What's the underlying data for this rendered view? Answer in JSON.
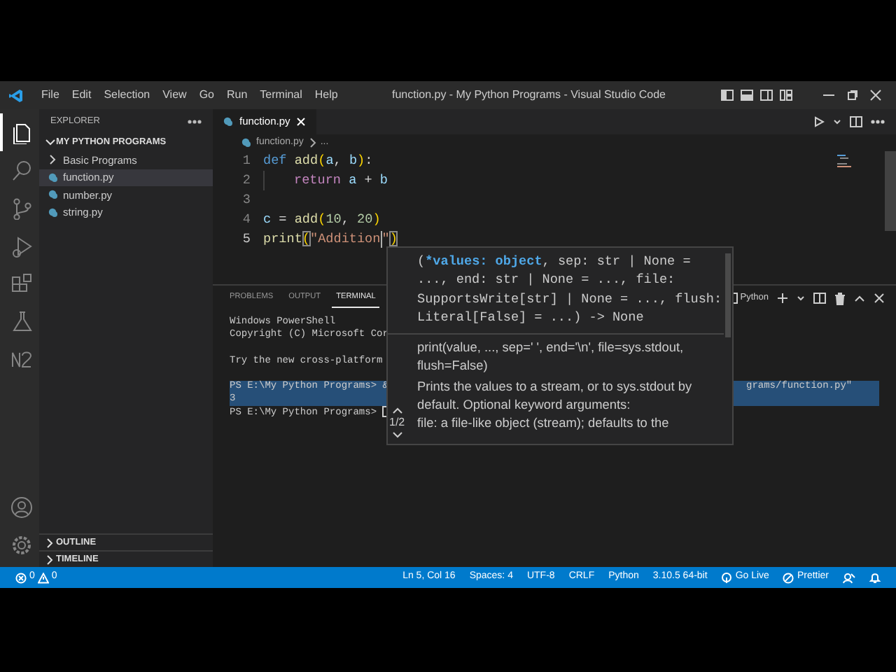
{
  "window": {
    "title": "function.py - My Python Programs - Visual Studio Code",
    "menu": [
      "File",
      "Edit",
      "Selection",
      "View",
      "Go",
      "Run",
      "Terminal",
      "Help"
    ]
  },
  "activity_bar": [
    {
      "kind": "explorer",
      "selected": true
    },
    {
      "kind": "search",
      "selected": false
    },
    {
      "kind": "source-control",
      "selected": false
    },
    {
      "kind": "run-debug",
      "selected": false
    },
    {
      "kind": "extensions",
      "selected": false
    },
    {
      "kind": "testing",
      "selected": false
    },
    {
      "kind": "extension-n2",
      "selected": false
    }
  ],
  "sidebar": {
    "title": "EXPLORER",
    "section": {
      "label": "MY PYTHON PROGRAMS",
      "expanded": true
    },
    "items": [
      {
        "kind": "folder",
        "label": "Basic Programs",
        "expanded": false,
        "selected": false
      },
      {
        "kind": "file",
        "label": "function.py",
        "selected": true
      },
      {
        "kind": "file",
        "label": "number.py",
        "selected": false
      },
      {
        "kind": "file",
        "label": "string.py",
        "selected": false
      }
    ],
    "bottom_sections": [
      {
        "label": "OUTLINE",
        "expanded": false
      },
      {
        "label": "TIMELINE",
        "expanded": false
      }
    ]
  },
  "editor": {
    "tabs": [
      {
        "label": "function.py",
        "selected": true
      }
    ],
    "breadcrumb": [
      "function.py",
      "..."
    ],
    "lines": [
      {
        "number": "1",
        "tokens": [
          {
            "text": "def",
            "kind": "keyword"
          },
          {
            "text": "add",
            "kind": "function",
            "space_before": true
          },
          {
            "text": "(",
            "kind": "bracket"
          },
          {
            "text": "a",
            "kind": "variable"
          },
          {
            "text": ", ",
            "kind": "plain"
          },
          {
            "text": "b",
            "kind": "variable"
          },
          {
            "text": ")",
            "kind": "bracket"
          },
          {
            "text": ":",
            "kind": "plain"
          }
        ]
      },
      {
        "number": "2",
        "tokens": [
          {
            "text": "return",
            "kind": "control",
            "indent": true
          },
          {
            "text": "a",
            "kind": "variable",
            "space_before": true
          },
          {
            "text": " + ",
            "kind": "plain"
          },
          {
            "text": "b",
            "kind": "variable"
          }
        ]
      },
      {
        "number": "3"
      },
      {
        "number": "4",
        "tokens": [
          {
            "text": "c",
            "kind": "variable"
          },
          {
            "text": " = ",
            "kind": "plain"
          },
          {
            "text": "add",
            "kind": "function"
          },
          {
            "text": "(",
            "kind": "bracket"
          },
          {
            "text": "10",
            "kind": "number"
          },
          {
            "text": ", ",
            "kind": "plain"
          },
          {
            "text": "20",
            "kind": "number"
          },
          {
            "text": ")",
            "kind": "bracket"
          }
        ]
      },
      {
        "number": "5",
        "tokens": [
          {
            "text": "print",
            "kind": "function"
          },
          {
            "text": "(",
            "kind": "bracket-match"
          },
          {
            "text": "\"Addition",
            "kind": "string",
            "cursor_after": true
          },
          {
            "text": "\"",
            "kind": "string"
          },
          {
            "text": ")",
            "kind": "bracket-match"
          }
        ]
      }
    ]
  },
  "hover": {
    "signature": {
      "prefix": "(",
      "active": "*values: object",
      "suffix": ", sep: str | None = ..., end: str | None = ..., file: SupportsWrite[str] | None = ..., flush: Literal[False] = ...) -> None"
    },
    "doc_paragraphs": [
      [
        "print(value, ..., sep=' ', end='\\n', file=sys.stdout, flush=False)"
      ],
      [
        "Prints the values to a stream, or to sys.stdout by default. Optional keyword arguments:",
        "file: a file-like object (stream); defaults to the"
      ]
    ],
    "overload": "1/2"
  },
  "panel": {
    "tabs": [
      {
        "label": "PROBLEMS",
        "selected": false
      },
      {
        "label": "OUTPUT",
        "selected": false
      },
      {
        "label": "TERMINAL",
        "selected": true
      }
    ],
    "terminal_name": "Python",
    "terminal_lines": [
      {
        "kind": "text",
        "text": "Windows PowerShell",
        "selected": false
      },
      {
        "kind": "text",
        "text": "Copyright (C) Microsoft Cor",
        "selected": false
      },
      {
        "kind": "blank"
      },
      {
        "kind": "text",
        "text": "Try the new cross-platform",
        "selected": false
      },
      {
        "kind": "blank"
      },
      {
        "kind": "text",
        "text": "PS E:\\My Python Programs> &",
        "continuation": "grams/function.py\"",
        "selected": true
      },
      {
        "kind": "text",
        "text": "3",
        "selected": true
      },
      {
        "kind": "text",
        "text": "PS E:\\My Python Programs>",
        "selected": false,
        "cursor": true
      }
    ]
  },
  "status_bar": {
    "errors": "0",
    "warnings": "0",
    "items": [
      {
        "kind": "text",
        "label": "Ln 5, Col 16"
      },
      {
        "kind": "text",
        "label": "Spaces: 4"
      },
      {
        "kind": "text",
        "label": "UTF-8"
      },
      {
        "kind": "text",
        "label": "CRLF"
      },
      {
        "kind": "text",
        "label": "Python"
      },
      {
        "kind": "text",
        "label": "3.10.5 64-bit"
      },
      {
        "kind": "go-live",
        "label": "Go Live"
      },
      {
        "kind": "prettier",
        "label": "Prettier"
      },
      {
        "kind": "feedback"
      },
      {
        "kind": "bell"
      }
    ]
  }
}
